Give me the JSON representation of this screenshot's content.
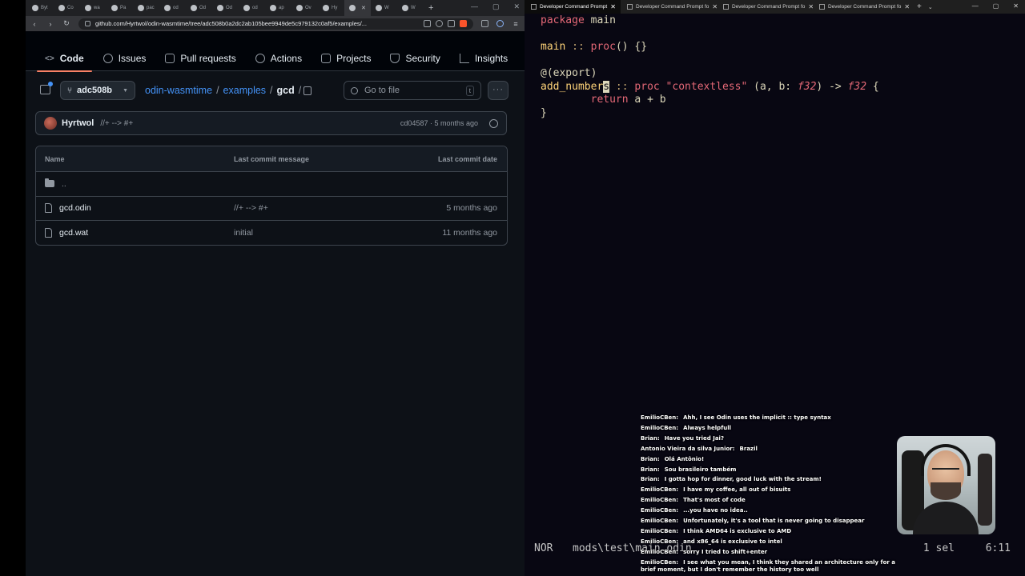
{
  "browser": {
    "tabs": [
      {
        "label": "Byt"
      },
      {
        "label": "Co"
      },
      {
        "label": "wa"
      },
      {
        "label": "Pa"
      },
      {
        "label": "pac"
      },
      {
        "label": "od"
      },
      {
        "label": "Od"
      },
      {
        "label": "Od"
      },
      {
        "label": "od"
      },
      {
        "label": "ap"
      },
      {
        "label": "Ov"
      },
      {
        "label": "Hy"
      },
      {
        "label": "",
        "active": true
      },
      {
        "label": "W"
      },
      {
        "label": "W"
      }
    ],
    "new_tab": "+",
    "url": "github.com/Hyrtwol/odin-wasmtime/tree/adc508b0a2dc2ab105bee9949de5c979132c0af5/examples/..."
  },
  "github": {
    "tabs": [
      {
        "label": "Code",
        "icon": "code-icon",
        "active": true
      },
      {
        "label": "Issues",
        "icon": "issue-icon"
      },
      {
        "label": "Pull requests",
        "icon": "pull-request-icon"
      },
      {
        "label": "Actions",
        "icon": "play-icon"
      },
      {
        "label": "Projects",
        "icon": "table-icon"
      },
      {
        "label": "Security",
        "icon": "shield-icon"
      },
      {
        "label": "Insights",
        "icon": "graph-icon"
      }
    ],
    "branch": "adc508b",
    "breadcrumb": {
      "repo": "odin-wasmtime",
      "sep": "/",
      "folder": "examples",
      "current": "gcd"
    },
    "goto_file_placeholder": "Go to file",
    "goto_file_key": "t",
    "more": "···",
    "commit": {
      "author": "Hyrtwol",
      "message": "//+ --> #+",
      "meta": "cd04587 · 5 months ago"
    },
    "table": {
      "headers": {
        "name": "Name",
        "message": "Last commit message",
        "date": "Last commit date"
      },
      "parent": "..",
      "files": [
        {
          "name": "gcd.odin",
          "message": "//+ --> #+",
          "date": "5 months ago"
        },
        {
          "name": "gcd.wat",
          "message": "initial",
          "date": "11 months ago"
        }
      ]
    }
  },
  "terminal": {
    "tabs": [
      {
        "label": "Developer Command Prompt",
        "active": true
      },
      {
        "label": "Developer Command Prompt fo"
      },
      {
        "label": "Developer Command Prompt fo"
      },
      {
        "label": "Developer Command Prompt fo"
      }
    ],
    "code": {
      "l1_kw": "package",
      "l1_name": " main",
      "l2_name": "main",
      "l2_op": " :: ",
      "l2_kw": "proc",
      "l2_rest": "() {}",
      "l3_attr": "@(export)",
      "l4_name_a": "add_number",
      "l4_cursor": "s",
      "l4_op": " :: ",
      "l4_kw": "proc",
      "l4_str": " \"contextless\"",
      "l4_params": " (a, b: ",
      "l4_type": "f32",
      "l4_arrow": ") -> ",
      "l4_ret": "f32",
      "l4_brace": " {",
      "l5_indent": "        ",
      "l5_kw": "return",
      "l5_expr": " a + b",
      "l6": "}"
    },
    "status": {
      "mode": "NOR",
      "path": "mods\\test\\main.odin",
      "selection": "1 sel",
      "position": "6:11"
    }
  },
  "chat": [
    {
      "user": "EmilioCBen:",
      "text": "Ahh, I see Odin uses the implicit :: type syntax"
    },
    {
      "user": "EmilioCBen:",
      "text": "Always helpfull"
    },
    {
      "user": "Brian:",
      "text": "Have you tried Jai?"
    },
    {
      "user": "Antonio Vieira da silva Junior:",
      "text": "Brazil"
    },
    {
      "user": "Brian:",
      "text": "Olá Antônio!"
    },
    {
      "user": "Brian:",
      "text": "Sou brasileiro também"
    },
    {
      "user": "Brian:",
      "text": "I gotta hop for dinner, good luck with the stream!"
    },
    {
      "user": "EmilioCBen:",
      "text": "I have my coffee, all out of bisuits"
    },
    {
      "user": "EmilioCBen:",
      "text": "That's most of code"
    },
    {
      "user": "EmilioCBen:",
      "text": "...you have no idea.."
    },
    {
      "user": "EmilioCBen:",
      "text": "Unfortunately, it's a tool that is never going to disappear"
    },
    {
      "user": "EmilioCBen:",
      "text": "I think AMD64 is exclusive to AMD"
    },
    {
      "user": "EmilioCBen:",
      "text": "and x86_64 is exclusive to intel"
    },
    {
      "user": "EmilioCBen:",
      "text": "sorry I tried to shift+enter"
    },
    {
      "user": "EmilioCBen:",
      "text": "I see what you mean, I think they shared an architecture only for a brief moment, but I don't remember the history too well"
    }
  ]
}
